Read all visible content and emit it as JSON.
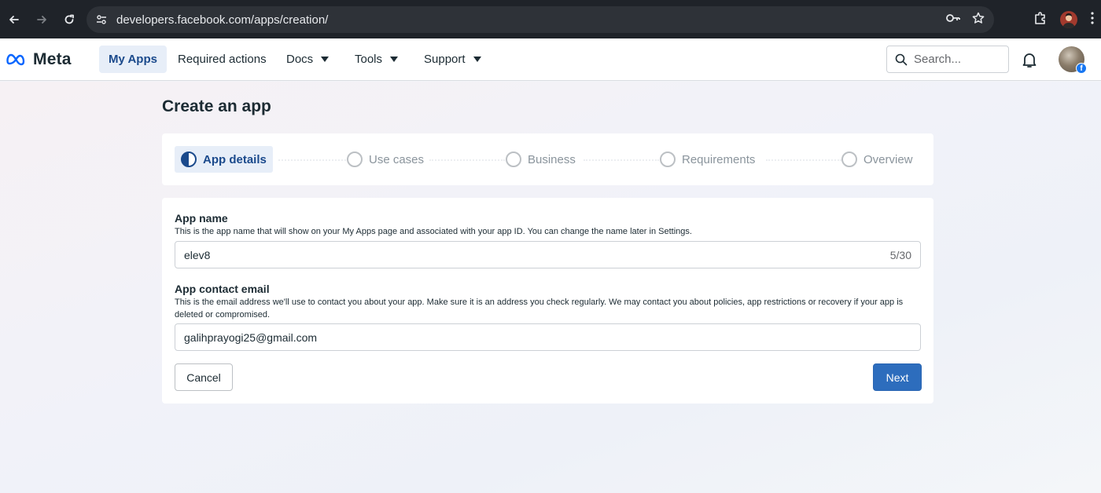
{
  "browser": {
    "url": "developers.facebook.com/apps/creation/"
  },
  "topnav": {
    "logo_text": "Meta",
    "items": [
      {
        "label": "My Apps"
      },
      {
        "label": "Required actions"
      },
      {
        "label": "Docs"
      },
      {
        "label": "Tools"
      },
      {
        "label": "Support"
      }
    ],
    "search_placeholder": "Search..."
  },
  "page": {
    "title": "Create an app"
  },
  "stepper": {
    "steps": [
      {
        "label": "App details",
        "state": "active"
      },
      {
        "label": "Use cases",
        "state": "pending"
      },
      {
        "label": "Business",
        "state": "pending"
      },
      {
        "label": "Requirements",
        "state": "pending"
      },
      {
        "label": "Overview",
        "state": "pending"
      }
    ]
  },
  "form": {
    "app_name": {
      "label": "App name",
      "help": "This is the app name that will show on your My Apps page and associated with your app ID. You can change the name later in Settings.",
      "value": "elev8",
      "counter": "5/30"
    },
    "contact_email": {
      "label": "App contact email",
      "help": "This is the email address we'll use to contact you about your app. Make sure it is an address you check regularly. We may contact you about policies, app restrictions or recovery if your app is deleted or compromised.",
      "value": "galihprayogi25@gmail.com"
    },
    "cancel_label": "Cancel",
    "next_label": "Next"
  },
  "colors": {
    "primary_button": "#2d6dbd",
    "active_step": "#1b4a8c",
    "active_bg": "#e7eef8"
  }
}
